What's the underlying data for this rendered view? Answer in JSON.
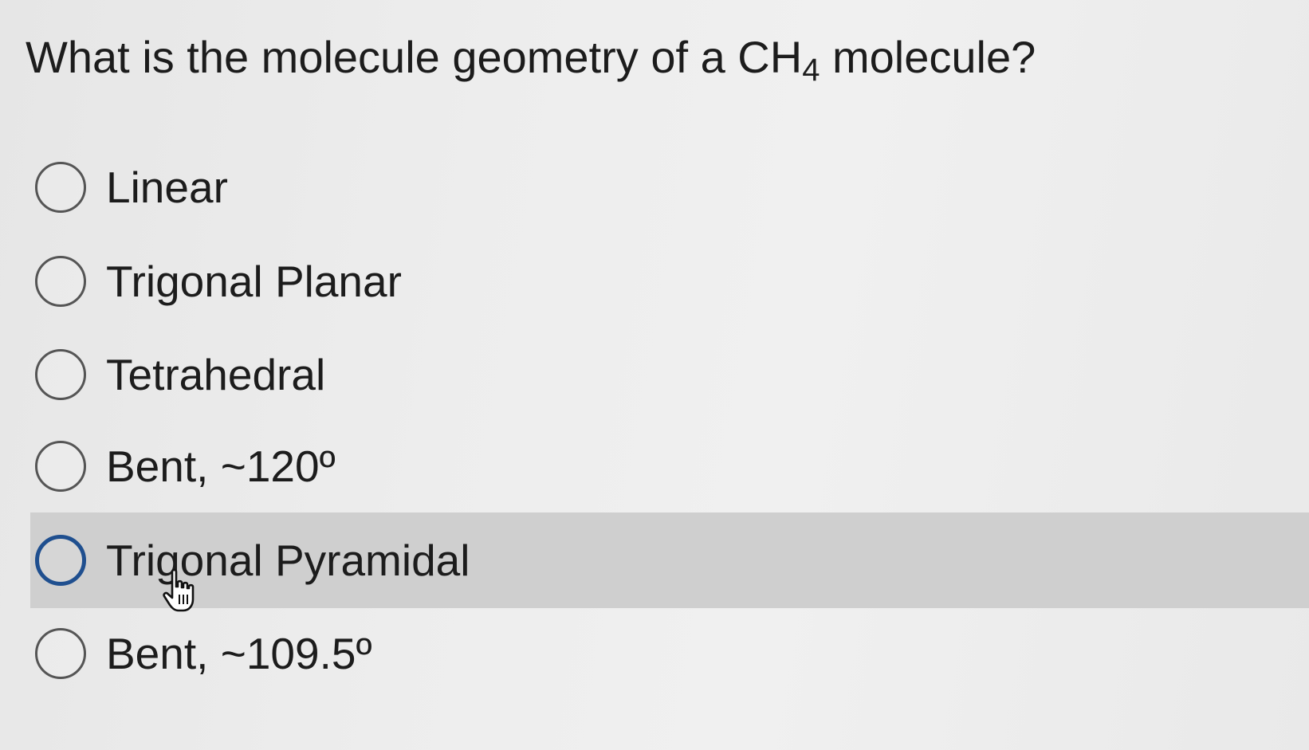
{
  "question": {
    "prefix": "What is the molecule geometry of a CH",
    "subscript": "4",
    "suffix": " molecule?"
  },
  "options": [
    {
      "label": "Linear",
      "hovered": false
    },
    {
      "label": "Trigonal Planar",
      "hovered": false
    },
    {
      "label": "Tetrahedral",
      "hovered": false
    },
    {
      "label": "Bent, ~120º",
      "hovered": false
    },
    {
      "label": "Trigonal Pyramidal",
      "hovered": true
    },
    {
      "label": "Bent, ~109.5º",
      "hovered": false
    }
  ],
  "colors": {
    "hover_background": "#cfcfcf",
    "focused_radio_border": "#1f4f8f",
    "radio_border": "#555555",
    "text": "#1c1c1c"
  },
  "icons": {
    "cursor": "hand-pointer-icon",
    "radio": "radio-circle-icon"
  }
}
